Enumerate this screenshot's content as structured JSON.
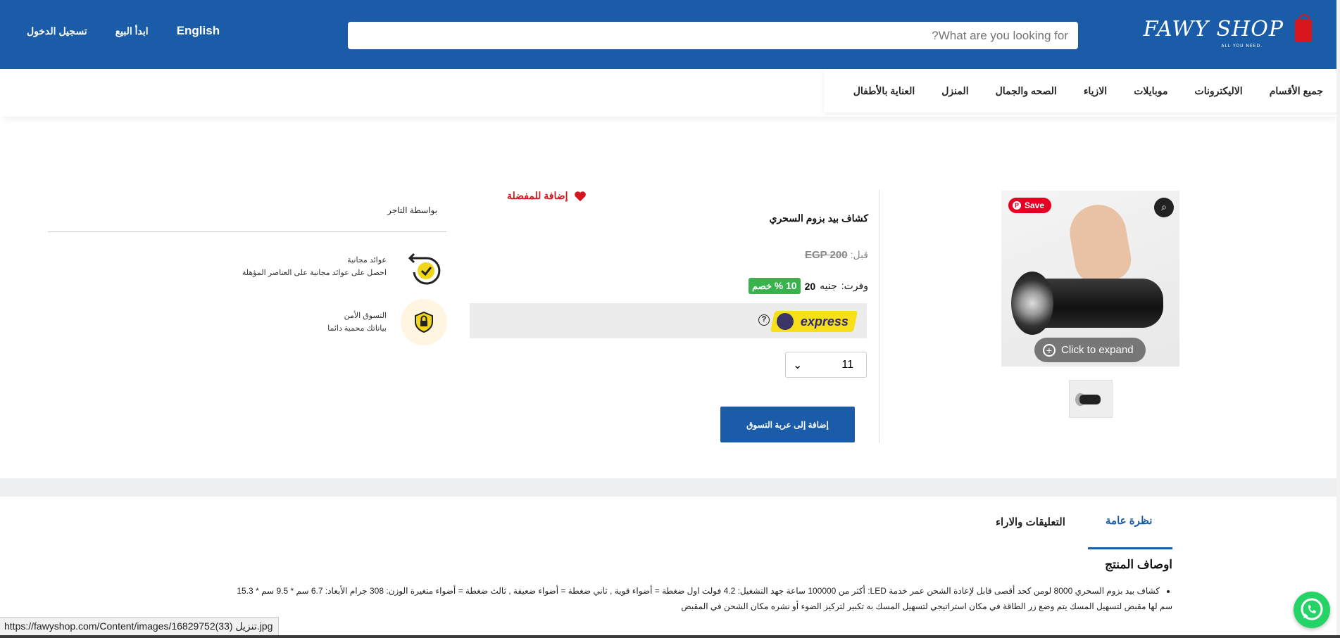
{
  "header": {
    "logo_text": "FAWY SHOP",
    "logo_tagline": "ALL YOU NEED.",
    "search_placeholder": "What are you looking for?",
    "links": {
      "english": "English",
      "start_selling": "ابدأ البيع",
      "login": "تسجيل الدخول"
    },
    "brand_color": "#1a5ca8"
  },
  "nav": {
    "items": [
      "جميع الأقسام",
      "الاليكترونات",
      "موبايلات",
      "الازياء",
      "الصحه والجمال",
      "المنزل",
      "العناية بالأطفال"
    ]
  },
  "gallery": {
    "pin_save": "Save",
    "expand_label": "Click to expand"
  },
  "product": {
    "title": "كشاف بيد بزوم السحري",
    "favorite_label": "إضافة للمفضلة",
    "old_price_label": "قبل:",
    "old_price": "EGP 200",
    "saved_label": "وفرت:",
    "saved_currency": "جنيه",
    "saved_amount": "20",
    "discount_value": "10 %",
    "discount_word": "خصم",
    "express_label": "express",
    "quantity": "11",
    "add_to_cart": "إضافة إلى عربة التسوق"
  },
  "side": {
    "seller": "بواسطة التاجر",
    "features": [
      {
        "title": "عوائد مجانية",
        "text": "احصل على عوائد مجانية على العناصر المؤهلة",
        "icon": "return-check-icon"
      },
      {
        "title": "التسوق الأمن",
        "text": "بياناتك محمية دائما",
        "icon": "secure-lock-icon"
      }
    ]
  },
  "tabs": {
    "overview": "نظرة عامة",
    "reviews": "التعليقات والاراء"
  },
  "description": {
    "heading": "اوصاف المنتج",
    "line1": "كشاف بيد بزوم السحري 8000 لومن كحد أقصى قابل لإعادة الشحن عمر خدمة LED: أكثر من 100000 ساعة جهد التشغيل: 4.2 فولت اول ضغطة = أضواء قوية , ثاني ضغطة = أضواء ضعيفة , ثالث ضغطة = أضواء متغيرة الوزن: 308 جرام الأبعاد: 6.7 سم * 9.5 سم * 15.3",
    "line2": "سم لها مقبض لتسهيل المسك يتم وضع زر الطاقة في مكان استراتيجي لتسهيل المسك به تكبير لتركيز الضوء أو نشره مكان الشحن في المقبض"
  },
  "status_bar": {
    "url": "https://fawyshop.com/Content/images/16829752(33) تنزيل.jpg"
  },
  "colors": {
    "discount": "#37b24d",
    "favorite": "#d7161d",
    "express_bg": "#f7e01a"
  }
}
